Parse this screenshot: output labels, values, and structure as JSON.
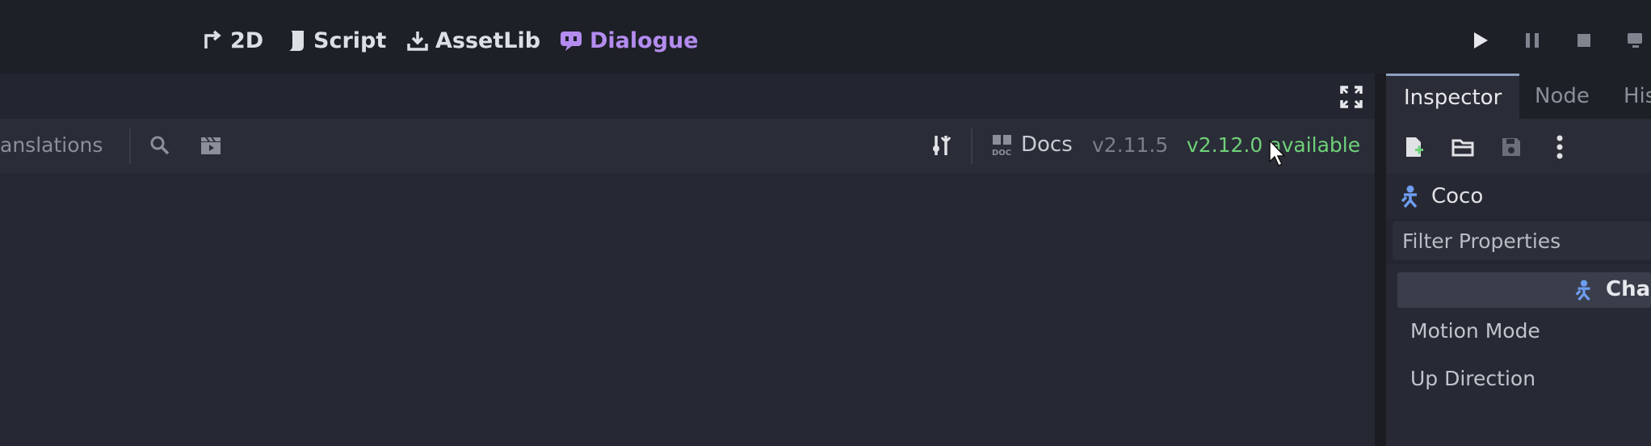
{
  "workspaces": [
    {
      "label": "2D",
      "icon": "2d-icon"
    },
    {
      "label": "Script",
      "icon": "script-icon"
    },
    {
      "label": "AssetLib",
      "icon": "assetlib-icon"
    },
    {
      "label": "Dialogue",
      "icon": "dialogue-icon"
    }
  ],
  "colors": {
    "accent_dialogue": "#b48cf0",
    "available_green": "#6fd07a",
    "node_blue": "#6e9cf0"
  },
  "run_controls": [
    "play-icon",
    "pause-icon",
    "stop-icon",
    "remote-debug-icon"
  ],
  "editor": {
    "toolbar": {
      "translations_label": "anslations",
      "docs_label": "Docs",
      "current_version": "v2.11.5",
      "available_version": "v2.12.0 available"
    }
  },
  "dock": {
    "tabs": [
      "Inspector",
      "Node",
      "His"
    ],
    "object_name": "Coco",
    "filter_placeholder": "Filter Properties",
    "section_title": "Chara",
    "properties": [
      "Motion Mode",
      "Up Direction"
    ]
  }
}
